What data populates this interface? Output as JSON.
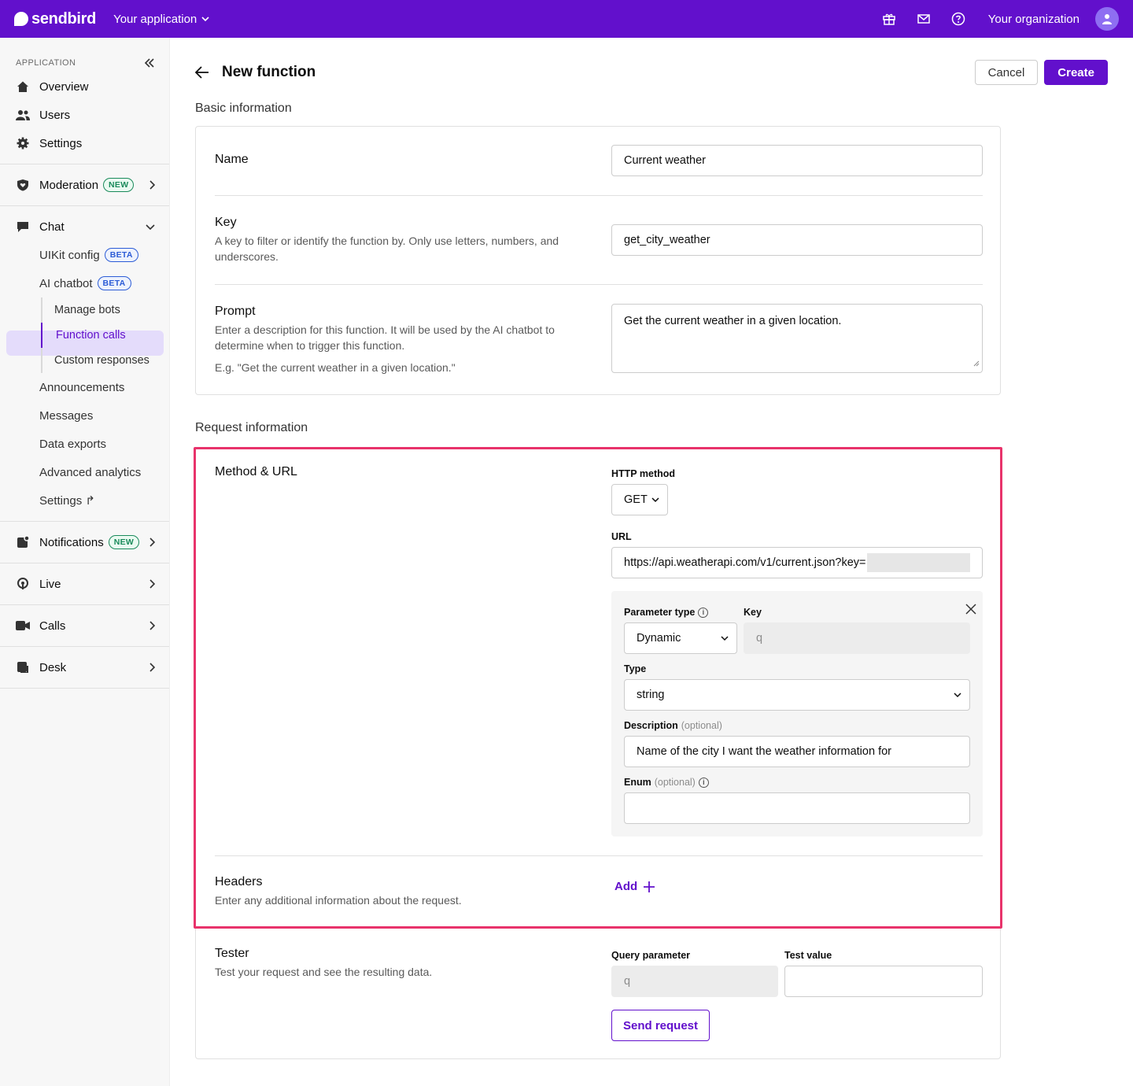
{
  "topbar": {
    "brand": "sendbird",
    "app_switcher": "Your application",
    "org_name": "Your organization",
    "icons": [
      "gift-icon",
      "mail-icon",
      "help-icon",
      "user-avatar-icon"
    ]
  },
  "sidebar": {
    "section_label": "APPLICATION",
    "top_items": [
      {
        "label": "Overview",
        "icon": "home-icon"
      },
      {
        "label": "Users",
        "icon": "users-icon"
      },
      {
        "label": "Settings",
        "icon": "gear-icon"
      }
    ],
    "moderation": {
      "label": "Moderation",
      "badge": "NEW"
    },
    "chat": {
      "label": "Chat",
      "uikit": {
        "label": "UIKit config",
        "badge": "BETA"
      },
      "ai_chatbot": {
        "label": "AI chatbot",
        "badge": "BETA"
      },
      "ai_children": [
        "Manage bots",
        "Function calls",
        "Custom responses"
      ],
      "active": "Function calls",
      "more": [
        "Announcements",
        "Messages",
        "Data exports",
        "Advanced analytics"
      ],
      "settings_link": "Settings ↱"
    },
    "notifications": {
      "label": "Notifications",
      "badge": "NEW"
    },
    "live": {
      "label": "Live"
    },
    "calls": {
      "label": "Calls"
    },
    "desk": {
      "label": "Desk"
    }
  },
  "page": {
    "title": "New function",
    "cancel_label": "Cancel",
    "create_label": "Create"
  },
  "basic_info": {
    "section_title": "Basic information",
    "name": {
      "label": "Name",
      "value": "Current weather"
    },
    "key": {
      "label": "Key",
      "desc": "A key to filter or identify the function by. Only use letters, numbers, and underscores.",
      "value": "get_city_weather"
    },
    "prompt": {
      "label": "Prompt",
      "desc": "Enter a description for this function. It will be used by the AI chatbot to determine when to trigger this function.",
      "example": "E.g. \"Get the current weather in a given location.\"",
      "value": "Get the current weather in a given location."
    }
  },
  "request_info": {
    "section_title": "Request information",
    "method_url": {
      "label": "Method & URL",
      "http_method_label": "HTTP method",
      "http_method": "GET",
      "url_label": "URL",
      "url_value": "https://api.weatherapi.com/v1/current.json?key="
    },
    "param": {
      "param_type_label": "Parameter type",
      "param_type": "Dynamic",
      "key_label": "Key",
      "key_placeholder": "q",
      "type_label": "Type",
      "type_value": "string",
      "description_label": "Description",
      "optional": "(optional)",
      "description_value": "Name of the city I want the weather information for",
      "enum_label": "Enum",
      "enum_value": ""
    },
    "headers": {
      "label": "Headers",
      "desc": "Enter any additional information about the request.",
      "add_label": "Add"
    }
  },
  "tester": {
    "label": "Tester",
    "desc": "Test your request and see the resulting data.",
    "query_param_label": "Query parameter",
    "query_param_value": "q",
    "test_value_label": "Test value",
    "test_value": "",
    "send_label": "Send request"
  },
  "colors": {
    "brand": "#6210cc",
    "highlight": "#e8336b",
    "active_bg": "#e4dcfb"
  }
}
